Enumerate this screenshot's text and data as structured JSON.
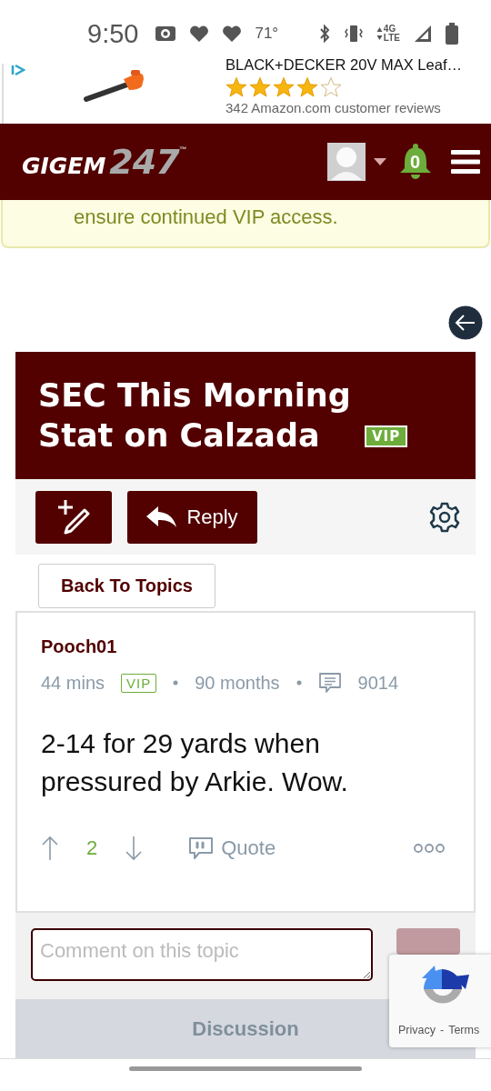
{
  "status_bar": {
    "time": "9:50",
    "temperature": "71°",
    "network": [
      "4G",
      "LTE"
    ]
  },
  "ad": {
    "title": "BLACK+DECKER 20V MAX Leaf…",
    "stars": 4,
    "reviews": "342 Amazon.com customer reviews"
  },
  "header": {
    "logo": {
      "word": "GIGEM",
      "number": "247",
      "mark": "™"
    },
    "notifications": "0"
  },
  "notice": {
    "text": "ensure continued VIP access."
  },
  "topic": {
    "title": "SEC This Morning Stat on Calzada",
    "badge": "VIP"
  },
  "toolbar": {
    "reply": "Reply"
  },
  "back_button": "Back To Topics",
  "post": {
    "author": "Pooch01",
    "time": "44 mins",
    "badge": "VIP",
    "tenure": "90 months",
    "post_count": "9014",
    "body": "2-14 for 29 yards when pressured by Arkie. Wow.",
    "votes": "2",
    "quote": "Quote"
  },
  "comment": {
    "placeholder": "Comment on this topic"
  },
  "discussion_tab": "Discussion",
  "recaptcha": {
    "links": [
      "Privacy",
      "Terms"
    ],
    "separator": "-"
  }
}
